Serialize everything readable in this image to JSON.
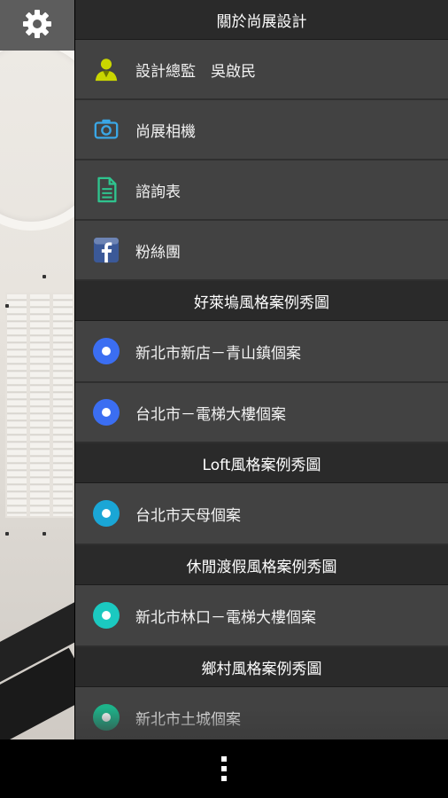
{
  "sections": [
    {
      "header": "關於尚展設計",
      "items": [
        {
          "label": "設計總監　吳啟民",
          "icon": "person-icon"
        },
        {
          "label": "尚展相機",
          "icon": "camera-icon"
        },
        {
          "label": "諮詢表",
          "icon": "document-icon"
        },
        {
          "label": "粉絲團",
          "icon": "facebook-icon"
        }
      ]
    },
    {
      "header": "好萊塢風格案例秀圖",
      "items": [
        {
          "label": "新北市新店－青山鎮個案",
          "icon": "dot-blue-icon",
          "color": "#3b6ef2"
        },
        {
          "label": "台北市－電梯大樓個案",
          "icon": "dot-blue-icon",
          "color": "#3b6ef2"
        }
      ]
    },
    {
      "header": "Loft風格案例秀圖",
      "items": [
        {
          "label": "台北市天母個案",
          "icon": "dot-cyan-icon",
          "color": "#1aa6d6"
        }
      ]
    },
    {
      "header": "休閒渡假風格案例秀圖",
      "items": [
        {
          "label": "新北市林口－電梯大樓個案",
          "icon": "dot-teal-icon",
          "color": "#1bc9c0"
        }
      ]
    },
    {
      "header": "鄉村風格案例秀圖",
      "items": [
        {
          "label": "新北市土城個案",
          "icon": "dot-green-icon",
          "color": "#1db38a"
        }
      ]
    }
  ],
  "colors": {
    "drawer_bg": "#424242",
    "header_bg": "#2a2a2a",
    "settings_bg": "#5d5d5d",
    "person_icon": "#c9d600",
    "camera_icon": "#3aa7e6",
    "document_icon": "#2fc48e",
    "facebook_icon": "#3b5998"
  }
}
